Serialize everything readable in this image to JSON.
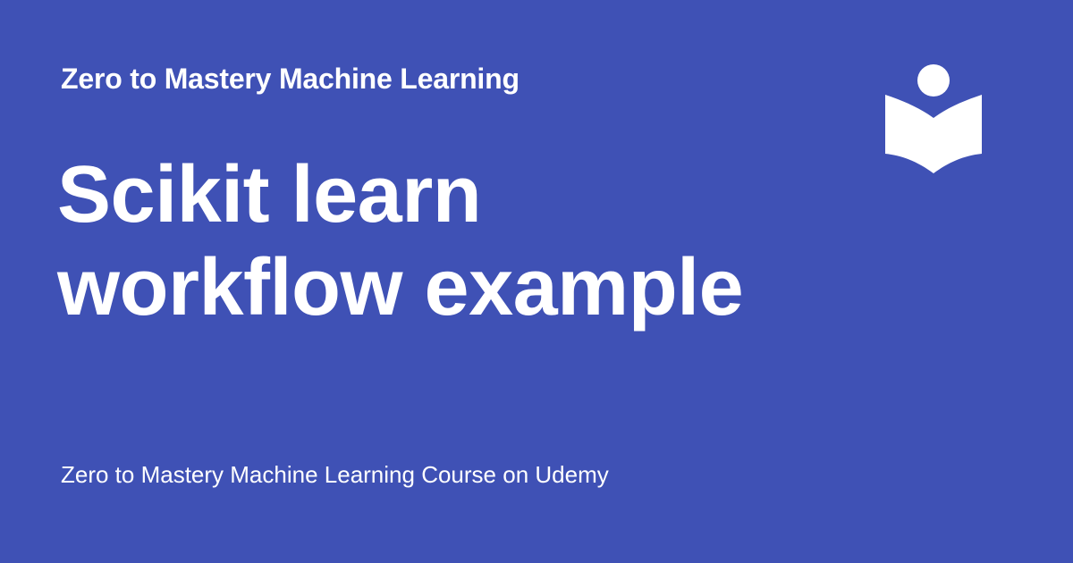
{
  "header": {
    "site_title": "Zero to Mastery Machine Learning"
  },
  "main": {
    "title_line1": "Scikit learn",
    "title_line2": "workflow example"
  },
  "footer": {
    "text": "Zero to Mastery Machine Learning Course on Udemy"
  },
  "logo": {
    "icon": "reader-book-icon"
  },
  "colors": {
    "background": "#3f51b5",
    "foreground": "#ffffff"
  }
}
